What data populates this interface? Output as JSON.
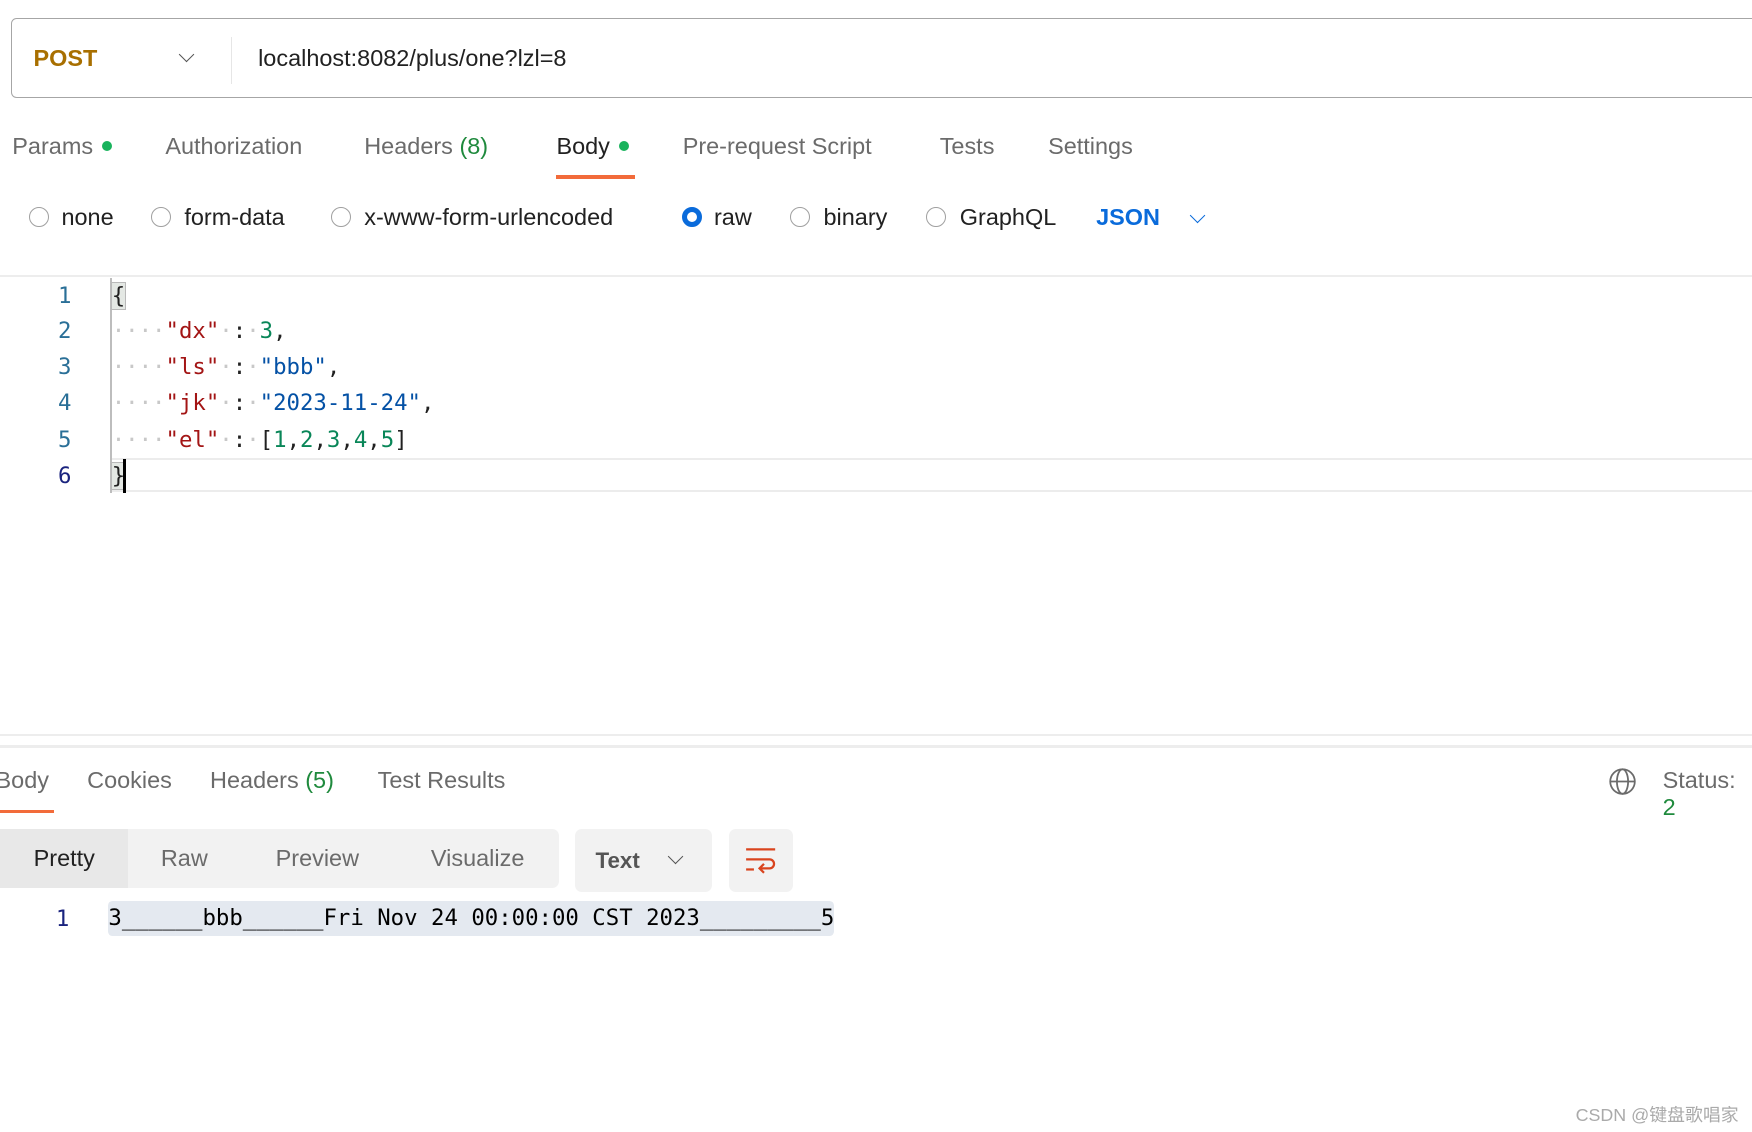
{
  "request": {
    "method": "POST",
    "url": "localhost:8082/plus/one?lzl=8",
    "tabs": [
      {
        "label": "Params",
        "dot": true
      },
      {
        "label": "Authorization"
      },
      {
        "label": "Headers",
        "count": "(8)"
      },
      {
        "label": "Body",
        "dot": true,
        "active": true
      },
      {
        "label": "Pre-request Script"
      },
      {
        "label": "Tests"
      },
      {
        "label": "Settings"
      }
    ],
    "body_types": [
      "none",
      "form-data",
      "x-www-form-urlencoded",
      "raw",
      "binary",
      "GraphQL"
    ],
    "selected_body_type": "raw",
    "format": "JSON",
    "editor": {
      "line_numbers": [
        "1",
        "2",
        "3",
        "4",
        "5",
        "6"
      ],
      "open_brace": "{",
      "close_brace": "}",
      "lines": [
        {
          "key": "\"dx\"",
          "value": "3",
          "type": "number",
          "trail": ","
        },
        {
          "key": "\"ls\"",
          "value": "\"bbb\"",
          "type": "string",
          "trail": ","
        },
        {
          "key": "\"jk\"",
          "value": "\"2023-11-24\"",
          "type": "string",
          "trail": ","
        },
        {
          "key": "\"el\"",
          "array": [
            "1",
            "2",
            "3",
            "4",
            "5"
          ]
        }
      ]
    }
  },
  "response": {
    "tabs": [
      {
        "label": "Body",
        "active": true
      },
      {
        "label": "Cookies"
      },
      {
        "label": "Headers",
        "count": "(5)"
      },
      {
        "label": "Test Results"
      }
    ],
    "status_label": "Status:",
    "status_partial": "2",
    "views": [
      "Pretty",
      "Raw",
      "Preview",
      "Visualize"
    ],
    "active_view": "Pretty",
    "format": "Text",
    "line_number": "1",
    "output": "3______bbb______Fri Nov 24 00:00:00 CST 2023_________5"
  },
  "watermark": "CSDN @键盘歌唱家",
  "colors": {
    "accent": "#f26b3a",
    "method": "#a86f00",
    "link": "#0a6bdb",
    "dot": "#19b35c"
  }
}
